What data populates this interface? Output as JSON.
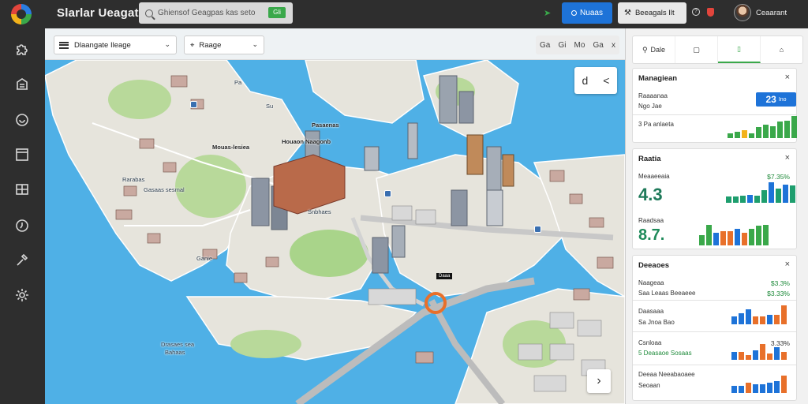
{
  "app": {
    "title": "Slarlar Ueagat",
    "user_name": "Ceaarant"
  },
  "search": {
    "value": "Ghiensof Geagpas kas seto",
    "go_label": "Gli"
  },
  "header": {
    "primary_button": "Nuaas",
    "workspace_button": "Beeagals Ilt",
    "help_glyph": "?"
  },
  "sidebar": {
    "items": [
      {
        "icon": "puzzle-icon"
      },
      {
        "icon": "building-icon"
      },
      {
        "icon": "chat-icon"
      },
      {
        "icon": "layout-icon"
      },
      {
        "icon": "grid-icon"
      },
      {
        "icon": "clock-icon"
      },
      {
        "icon": "hammer-icon"
      },
      {
        "icon": "settings-icon"
      }
    ]
  },
  "map": {
    "layer_select": "Dlaangate Ileage",
    "range_select": "Raage",
    "tools": [
      "Ga",
      "Gi",
      "Mo",
      "Ga",
      "x"
    ],
    "zoom_glyphs": [
      "d",
      "<"
    ],
    "next_glyph": "›",
    "labels": {
      "top_center": "Pasaenas",
      "center_top": "Mouas-lesiea",
      "center_main": "Houaon Naagonb",
      "left_area": "Rarabas",
      "left_mid": "Gasaas sesmal",
      "left_mid2": "Snbhaes",
      "left_low": "Ganie",
      "bottom_left1": "Drasaes sea",
      "bottom_left2": "Bahaas",
      "sign": "Daaa",
      "small_a": "Pa",
      "small_b": "Su"
    },
    "colors": {
      "water": "#4fb0e6",
      "land": "#e6e4dc",
      "park": "#b8d99a",
      "road": "#d2d2d2"
    }
  },
  "panel": {
    "tabs": [
      {
        "label": "Dale",
        "icon": "pin-icon"
      },
      {
        "label": "",
        "icon": "bookmark-icon"
      },
      {
        "label": "",
        "icon": "document-icon"
      },
      {
        "label": "",
        "icon": "home-icon"
      }
    ],
    "management": {
      "title": "Managiean",
      "row1": "Raaaanaa",
      "row2": "Ngo Jae",
      "kpi_value": "23",
      "kpi_unit": "Ino",
      "row3": "3 Pa anlaeta",
      "bars": [
        {
          "v": 0.2,
          "c": "#3aa84a"
        },
        {
          "v": 0.3,
          "c": "#3aa84a"
        },
        {
          "v": 0.35,
          "c": "#f2b21b"
        },
        {
          "v": 0.2,
          "c": "#3aa84a"
        },
        {
          "v": 0.5,
          "c": "#3aa84a"
        },
        {
          "v": 0.6,
          "c": "#3aa84a"
        },
        {
          "v": 0.55,
          "c": "#3aa84a"
        },
        {
          "v": 0.75,
          "c": "#3aa84a"
        },
        {
          "v": 0.8,
          "c": "#3aa84a"
        },
        {
          "v": 1.0,
          "c": "#3aa84a"
        }
      ]
    },
    "stats": {
      "title": "Raatia",
      "row1": "Meaaeeaia",
      "row1_pct": "$7.35%",
      "big1": "4.3",
      "row2": "Raadsaa",
      "big2": "8.7.",
      "bars1": [
        {
          "v": 0.3,
          "c": "#1e9e6e"
        },
        {
          "v": 0.3,
          "c": "#1e9e6e"
        },
        {
          "v": 0.35,
          "c": "#1e9e6e"
        },
        {
          "v": 0.4,
          "c": "#1e73d8"
        },
        {
          "v": 0.35,
          "c": "#1e9e6e"
        },
        {
          "v": 0.6,
          "c": "#1e9e6e"
        },
        {
          "v": 1.0,
          "c": "#1e73d8"
        },
        {
          "v": 0.7,
          "c": "#1e9e6e"
        },
        {
          "v": 0.9,
          "c": "#1e73d8"
        },
        {
          "v": 0.85,
          "c": "#1e9e6e"
        }
      ],
      "bars2": [
        {
          "v": 0.5,
          "c": "#3aa84a"
        },
        {
          "v": 1.0,
          "c": "#3aa84a"
        },
        {
          "v": 0.6,
          "c": "#1e73d8"
        },
        {
          "v": 0.7,
          "c": "#e8702a"
        },
        {
          "v": 0.7,
          "c": "#e8702a"
        },
        {
          "v": 0.8,
          "c": "#1e73d8"
        },
        {
          "v": 0.6,
          "c": "#e8702a"
        },
        {
          "v": 0.8,
          "c": "#3aa84a"
        },
        {
          "v": 0.95,
          "c": "#3aa84a"
        },
        {
          "v": 1.0,
          "c": "#3aa84a"
        }
      ]
    },
    "details": {
      "title": "Deeaoes",
      "row1": "Naageaa",
      "row1_pct": "$3.3%",
      "row2": "Saa Leaas Beeaeee",
      "row2_pct": "$3.33%",
      "row3": "Daasaaa",
      "row4": "Sa Jnoa Bao",
      "bars1": [
        {
          "v": 0.4,
          "c": "#1e73d8"
        },
        {
          "v": 0.6,
          "c": "#1e73d8"
        },
        {
          "v": 0.8,
          "c": "#1e73d8"
        },
        {
          "v": 0.4,
          "c": "#e8702a"
        },
        {
          "v": 0.4,
          "c": "#e8702a"
        },
        {
          "v": 0.5,
          "c": "#1e73d8"
        },
        {
          "v": 0.5,
          "c": "#e8702a"
        },
        {
          "v": 1.0,
          "c": "#e8702a"
        }
      ],
      "row5": "Csnloaa",
      "row5_pct": "3.33%",
      "row6": "5 Deasaoe Sosaas",
      "bars2": [
        {
          "v": 0.5,
          "c": "#1e73d8"
        },
        {
          "v": 0.5,
          "c": "#e8702a"
        },
        {
          "v": 0.3,
          "c": "#e8702a"
        },
        {
          "v": 0.6,
          "c": "#1e73d8"
        },
        {
          "v": 1.0,
          "c": "#e8702a"
        },
        {
          "v": 0.4,
          "c": "#e8702a"
        },
        {
          "v": 0.8,
          "c": "#1e73d8"
        },
        {
          "v": 0.5,
          "c": "#e8702a"
        }
      ],
      "row7": "Deeaa Neeabaoaee",
      "row8": "Seoaan",
      "bars3": [
        {
          "v": 0.4,
          "c": "#1e73d8"
        },
        {
          "v": 0.4,
          "c": "#1e73d8"
        },
        {
          "v": 0.6,
          "c": "#e8702a"
        },
        {
          "v": 0.5,
          "c": "#1e73d8"
        },
        {
          "v": 0.5,
          "c": "#1e73d8"
        },
        {
          "v": 0.6,
          "c": "#1e73d8"
        },
        {
          "v": 0.7,
          "c": "#1e73d8"
        },
        {
          "v": 1.0,
          "c": "#e8702a"
        }
      ]
    }
  }
}
